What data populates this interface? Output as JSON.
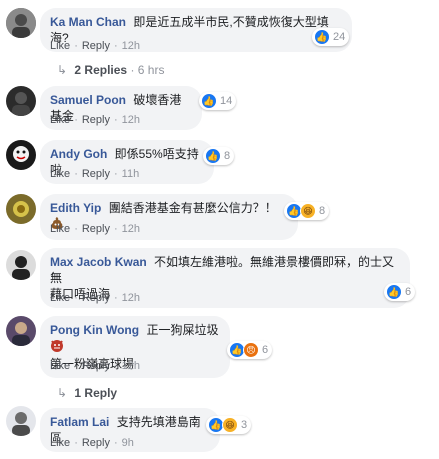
{
  "labels": {
    "like": "Like",
    "reply": "Reply"
  },
  "comments": [
    {
      "author": "Ka Man Chan",
      "text": "即是近五成半市民,不贊成恢復大型填海?",
      "time": "12h",
      "reactions": "24"
    },
    {
      "author": "Samuel Poon",
      "text": "破壞香港基金",
      "time": "12h",
      "reactions": "14"
    },
    {
      "author": "Andy Goh",
      "text": "即係55%唔支持啦",
      "time": "11h",
      "reactions": "8"
    },
    {
      "author": "Edith Yip",
      "text": "團結香港基金有甚麼公信力？！",
      "time": "12h",
      "reactions": "8"
    },
    {
      "author": "Max Jacob Kwan",
      "text_line1": "不如填左維港啦。無維港景樓價即冧，的士又無",
      "text_line2": "藉口唔過海",
      "time": "12h",
      "reactions": "6"
    },
    {
      "author": "Pong Kin Wong",
      "text_line1": "正一狗屎垃圾",
      "text_line2": "第一粉嶺高球場",
      "time": "12h",
      "reactions": "6"
    },
    {
      "author": "Fatlam Lai",
      "text": "支持先填港島南區",
      "time": "9h",
      "reactions": "3"
    }
  ],
  "replies_1": {
    "label": "2 Replies",
    "time": "6 hrs"
  },
  "replies_6": {
    "label": "1 Reply"
  },
  "colors": {
    "link": "#385898",
    "bubble": "#f2f3f5",
    "like": "#1877f2"
  }
}
